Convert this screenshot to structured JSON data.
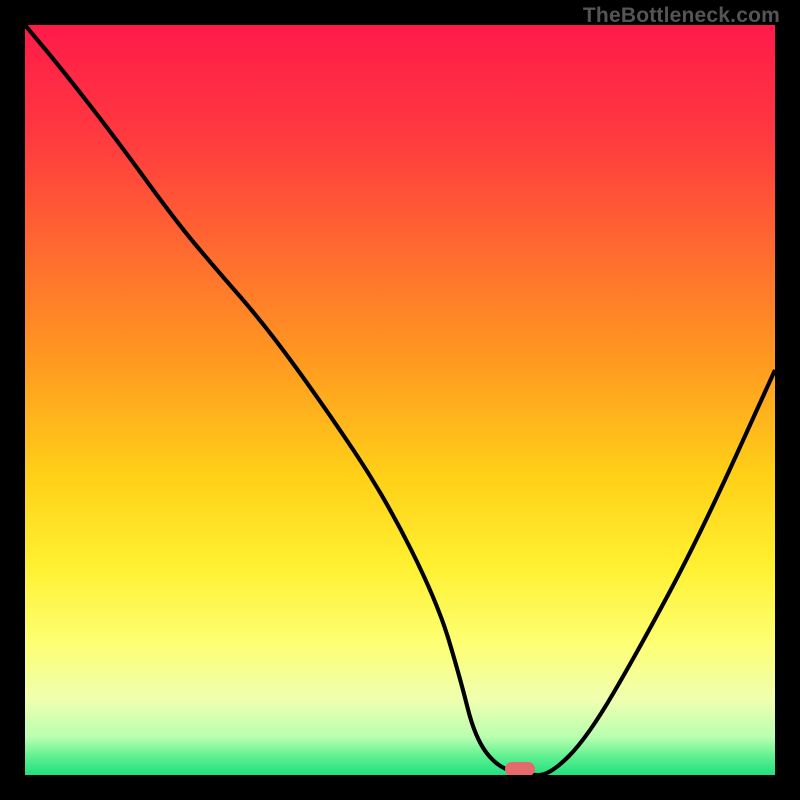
{
  "watermark": "TheBottleneck.com",
  "colors": {
    "frame": "#000000",
    "marker": "#e46a6b",
    "curve": "#000000"
  },
  "gradient_stops": [
    {
      "offset": 0.0,
      "color": "#ff1a4a"
    },
    {
      "offset": 0.15,
      "color": "#ff3a3f"
    },
    {
      "offset": 0.3,
      "color": "#ff6a30"
    },
    {
      "offset": 0.45,
      "color": "#ff9a20"
    },
    {
      "offset": 0.6,
      "color": "#ffd018"
    },
    {
      "offset": 0.72,
      "color": "#fff030"
    },
    {
      "offset": 0.82,
      "color": "#feff70"
    },
    {
      "offset": 0.9,
      "color": "#f0ffb0"
    },
    {
      "offset": 0.95,
      "color": "#b8ffb0"
    },
    {
      "offset": 0.975,
      "color": "#60f090"
    },
    {
      "offset": 1.0,
      "color": "#20e080"
    }
  ],
  "chart_data": {
    "type": "line",
    "title": "",
    "xlabel": "",
    "ylabel": "",
    "xlim": [
      0,
      100
    ],
    "ylim": [
      0,
      100
    ],
    "series": [
      {
        "name": "bottleneck-curve",
        "x": [
          0,
          5,
          12,
          20,
          25,
          32,
          40,
          48,
          55,
          58,
          60,
          63,
          67,
          70,
          75,
          82,
          90,
          100
        ],
        "y": [
          100,
          94,
          85,
          74,
          68,
          60,
          49,
          37,
          23,
          13,
          5,
          1,
          0,
          0,
          5,
          17,
          32,
          54
        ]
      }
    ],
    "marker": {
      "x": 66,
      "y": 0.8
    }
  }
}
